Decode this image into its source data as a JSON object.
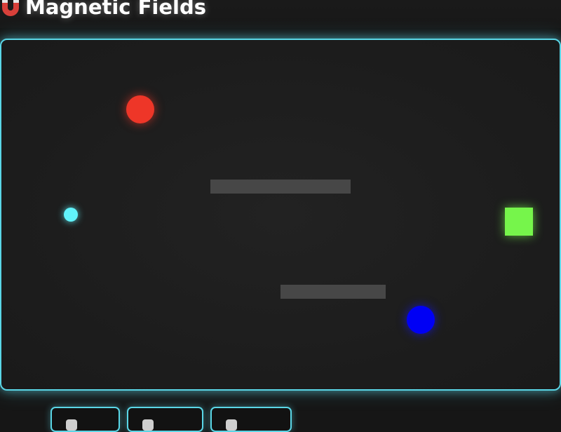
{
  "header": {
    "title": "Magnetic Fields",
    "icon": "magnet-icon"
  },
  "board": {
    "border_color": "#5ad6e6",
    "magnets": [
      {
        "polarity": "red",
        "color": "#ee3628"
      },
      {
        "polarity": "blue",
        "color": "#0000f5"
      }
    ],
    "ball_color": "#61f3fb",
    "goal_color": "#76f54b",
    "wall_color": "#474747"
  },
  "controls": {
    "buttons": [
      {
        "icon": "button-icon"
      },
      {
        "icon": "button-icon"
      },
      {
        "icon": "button-icon"
      }
    ]
  }
}
